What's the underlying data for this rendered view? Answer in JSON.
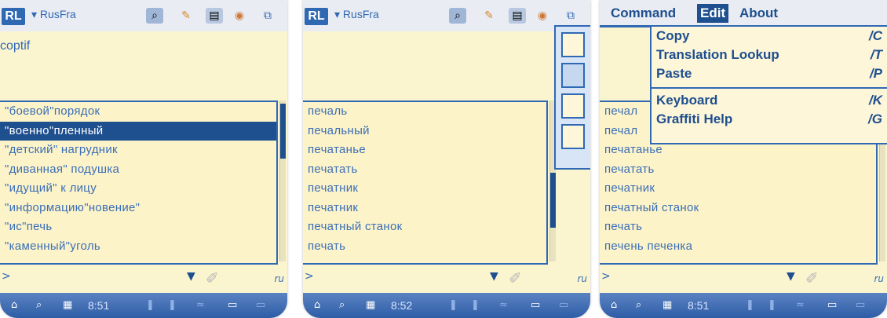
{
  "panels": [
    {
      "app_logo": "RL",
      "dictionary": "RusFra",
      "query": "coptif",
      "list": [
        "\"боевой\"порядок",
        "\"военно\"пленный",
        "\"детский\" нагрудник",
        "\"диванная\" подушка",
        "\"идущий\" к лицу",
        "\"информацию\"новение\"",
        "\"ис\"печь",
        "\"каменный\"уголь"
      ],
      "selected_index": 1,
      "input_prompt": ">",
      "lang": "ru",
      "time": "8:51"
    },
    {
      "app_logo": "RL",
      "dictionary": "RusFra",
      "list": [
        "печаль",
        "печальный",
        "печатанье",
        "печатать",
        "печатник",
        "печатник",
        "печатный станок",
        "печать"
      ],
      "input_prompt": ">",
      "lang": "ru",
      "time": "8:52"
    },
    {
      "menubar": [
        "Command",
        "Edit",
        "About"
      ],
      "active_menu": "Edit",
      "menu_items": [
        {
          "label": "Copy",
          "shortcut": "/C"
        },
        {
          "label": "Translation Lookup",
          "shortcut": "/T"
        },
        {
          "label": "Paste",
          "shortcut": "/P"
        },
        {
          "label": "Keyboard",
          "shortcut": "/K"
        },
        {
          "label": "Graffiti Help",
          "shortcut": "/G"
        }
      ],
      "list": [
        "печал",
        "печал",
        "печатанье",
        "печатать",
        "печатник",
        "печатный станок",
        "печать",
        "печень печенка"
      ],
      "input_prompt": ">",
      "lang": "ru",
      "time": "8:51"
    }
  ],
  "colors": {
    "accent": "#2f69b4",
    "selection": "#1e4f8f",
    "list_bg": "#fdf3c8",
    "status_bar": "#2e5da6"
  }
}
